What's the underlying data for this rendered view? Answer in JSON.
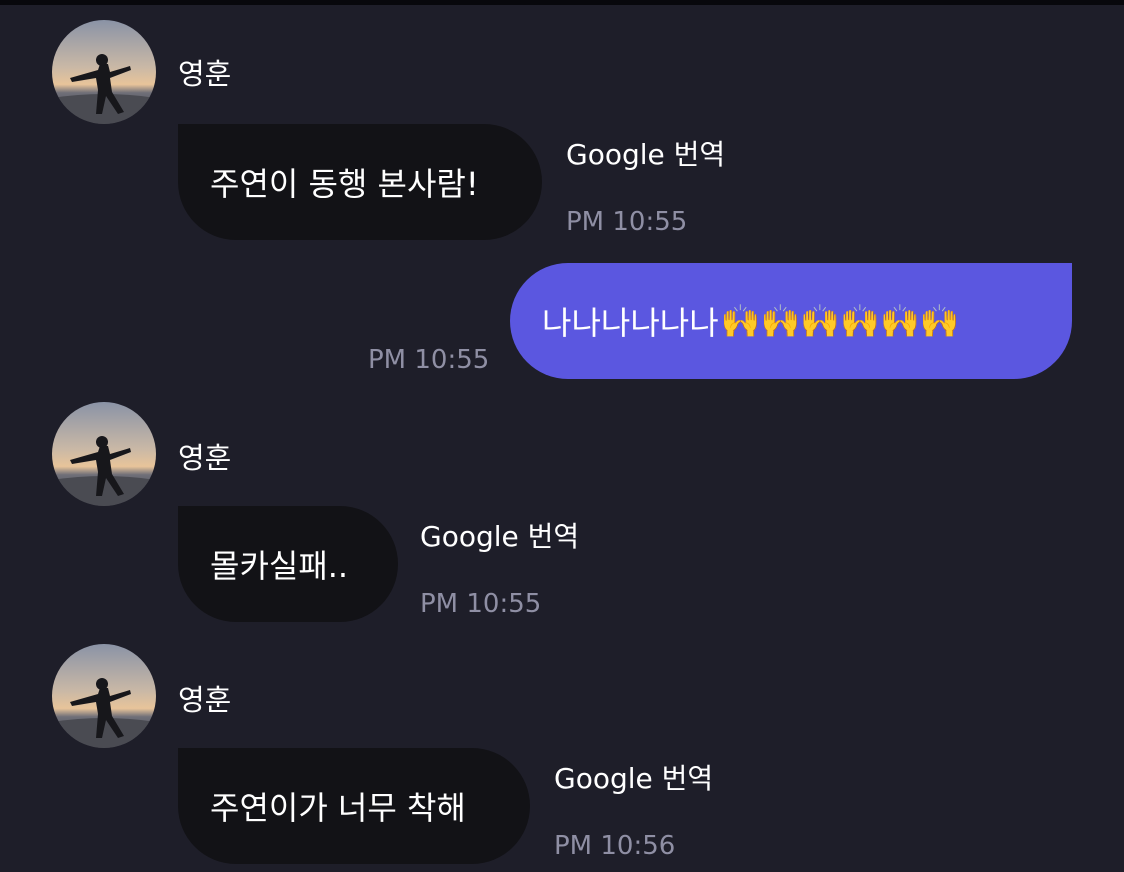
{
  "colors": {
    "background": "#1e1e29",
    "incoming_bubble": "#121216",
    "outgoing_bubble": "#5b57e0",
    "timestamp": "#8f8fa4"
  },
  "messages": [
    {
      "direction": "incoming",
      "sender": "영훈",
      "avatar_icon": "profile-photo",
      "text": "주연이 동행 본사람!",
      "translate_label": "Google 번역",
      "time": "PM 10:55"
    },
    {
      "direction": "outgoing",
      "text": "나나나나나나",
      "emoji": "🙌🙌🙌🙌🙌🙌",
      "emoji_icon": "raising-hands-icon",
      "time": "PM 10:55"
    },
    {
      "direction": "incoming",
      "sender": "영훈",
      "avatar_icon": "profile-photo",
      "text": "몰카실패..",
      "translate_label": "Google 번역",
      "time": "PM 10:55"
    },
    {
      "direction": "incoming",
      "sender": "영훈",
      "avatar_icon": "profile-photo",
      "text": "주연이가 너무 착해",
      "translate_label": "Google 번역",
      "time": "PM 10:56"
    }
  ]
}
